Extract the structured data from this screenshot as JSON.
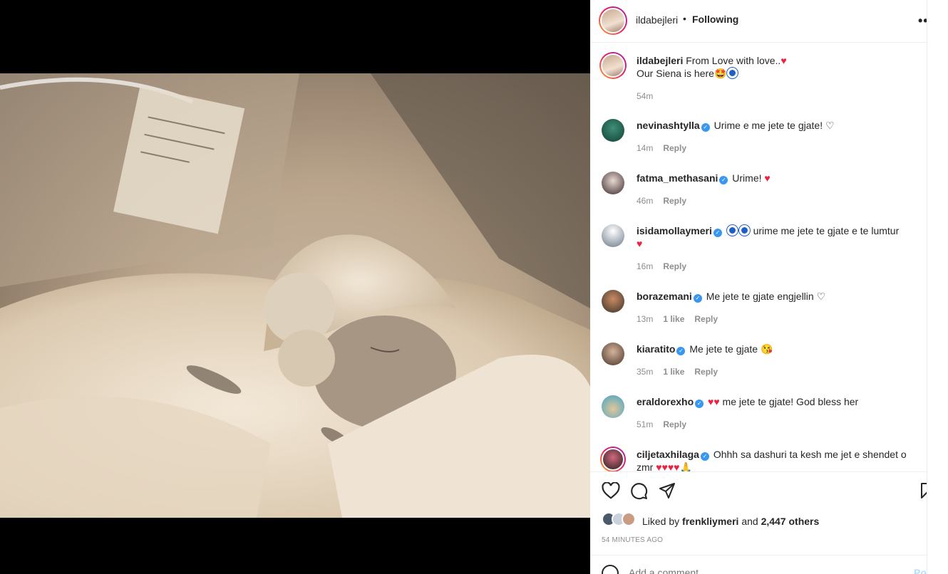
{
  "post": {
    "username": "ildabejleri",
    "separator": "•",
    "follow_status": "Following",
    "caption_line1": "From Love with love..",
    "caption_line2": "Our Siena is here",
    "caption_time": "54m"
  },
  "comments": [
    {
      "username": "nevinashtylla",
      "text": "Urime e me jete te gjate!",
      "time": "14m",
      "likes": "",
      "reply": "Reply"
    },
    {
      "username": "fatma_methasani",
      "text": "Urime!",
      "time": "46m",
      "likes": "",
      "reply": "Reply"
    },
    {
      "username": "isidamollaymeri",
      "text": "urime me jete te gjate e te lumtur",
      "time": "16m",
      "likes": "",
      "reply": "Reply"
    },
    {
      "username": "borazemani",
      "text": "Me jete te gjate engjellin",
      "time": "13m",
      "likes": "1 like",
      "reply": "Reply"
    },
    {
      "username": "kiaratito",
      "text": "Me jete te gjate",
      "time": "35m",
      "likes": "1 like",
      "reply": "Reply"
    },
    {
      "username": "eraldorexho",
      "text": "me jete te gjate! God bless her",
      "time": "51m",
      "likes": "",
      "reply": "Reply"
    },
    {
      "username": "ciljetaxhilaga",
      "text": "Ohhh sa dashuri ta kesh me jet e shendet o",
      "text2": "zmr",
      "time": "",
      "likes": "",
      "reply": ""
    }
  ],
  "likes": {
    "prefix": "Liked by",
    "user": "frenkliymeri",
    "conj": "and",
    "others": "2,447 others"
  },
  "timestamp": "54 MINUTES AGO",
  "comment_box": {
    "placeholder": "Add a comment...",
    "post_label": "Post"
  },
  "icons": {
    "more": "more-options-icon",
    "like": "heart-icon",
    "comment": "comment-icon",
    "share": "share-icon",
    "save": "bookmark-icon",
    "emoji": "emoji-icon"
  },
  "colors": {
    "verified": "#3897f0",
    "heart": "#ed2141",
    "post_button": "#b2dffc",
    "muted_text": "#8e8e8e"
  }
}
